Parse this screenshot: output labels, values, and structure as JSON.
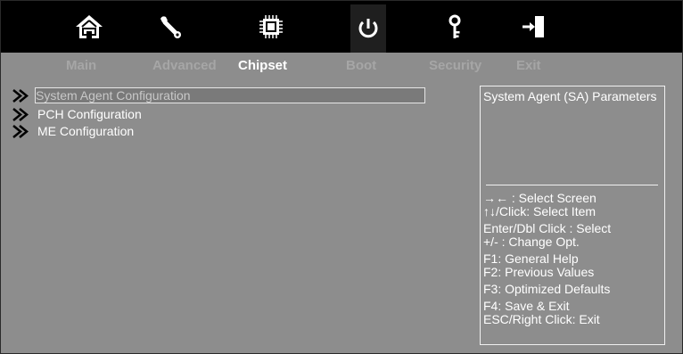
{
  "top_icons": [
    {
      "name": "home-icon",
      "active": false
    },
    {
      "name": "wrench-icon",
      "active": false
    },
    {
      "name": "chip-icon",
      "active": false
    },
    {
      "name": "power-icon",
      "active": true
    },
    {
      "name": "key-icon",
      "active": false
    },
    {
      "name": "exit-door-icon",
      "active": false
    }
  ],
  "tabs": [
    {
      "label": "Main",
      "active": false
    },
    {
      "label": "Advanced",
      "active": false
    },
    {
      "label": "Chipset",
      "active": true
    },
    {
      "label": "Boot",
      "active": false
    },
    {
      "label": "Security",
      "active": false
    },
    {
      "label": "Exit",
      "active": false
    }
  ],
  "menu": {
    "items": [
      {
        "label": "System Agent Configuration",
        "selected": true
      },
      {
        "label": "PCH Configuration",
        "selected": false
      },
      {
        "label": "ME Configuration",
        "selected": false
      }
    ]
  },
  "help": {
    "description": "System Agent (SA) Parameters",
    "keys": [
      [
        "→←  : Select Screen",
        "↑↓/Click: Select Item"
      ],
      [
        "Enter/Dbl Click : Select",
        "+/- : Change Opt."
      ],
      [
        "F1: General Help",
        "F2: Previous Values"
      ],
      [
        "F3: Optimized Defaults"
      ],
      [
        "F4: Save & Exit",
        "ESC/Right Click: Exit"
      ]
    ]
  },
  "colors": {
    "background": "#8d8d8d",
    "topbar": "#000000",
    "active_tab": "#ffffff",
    "inactive_tab": "#a6a6a6"
  }
}
